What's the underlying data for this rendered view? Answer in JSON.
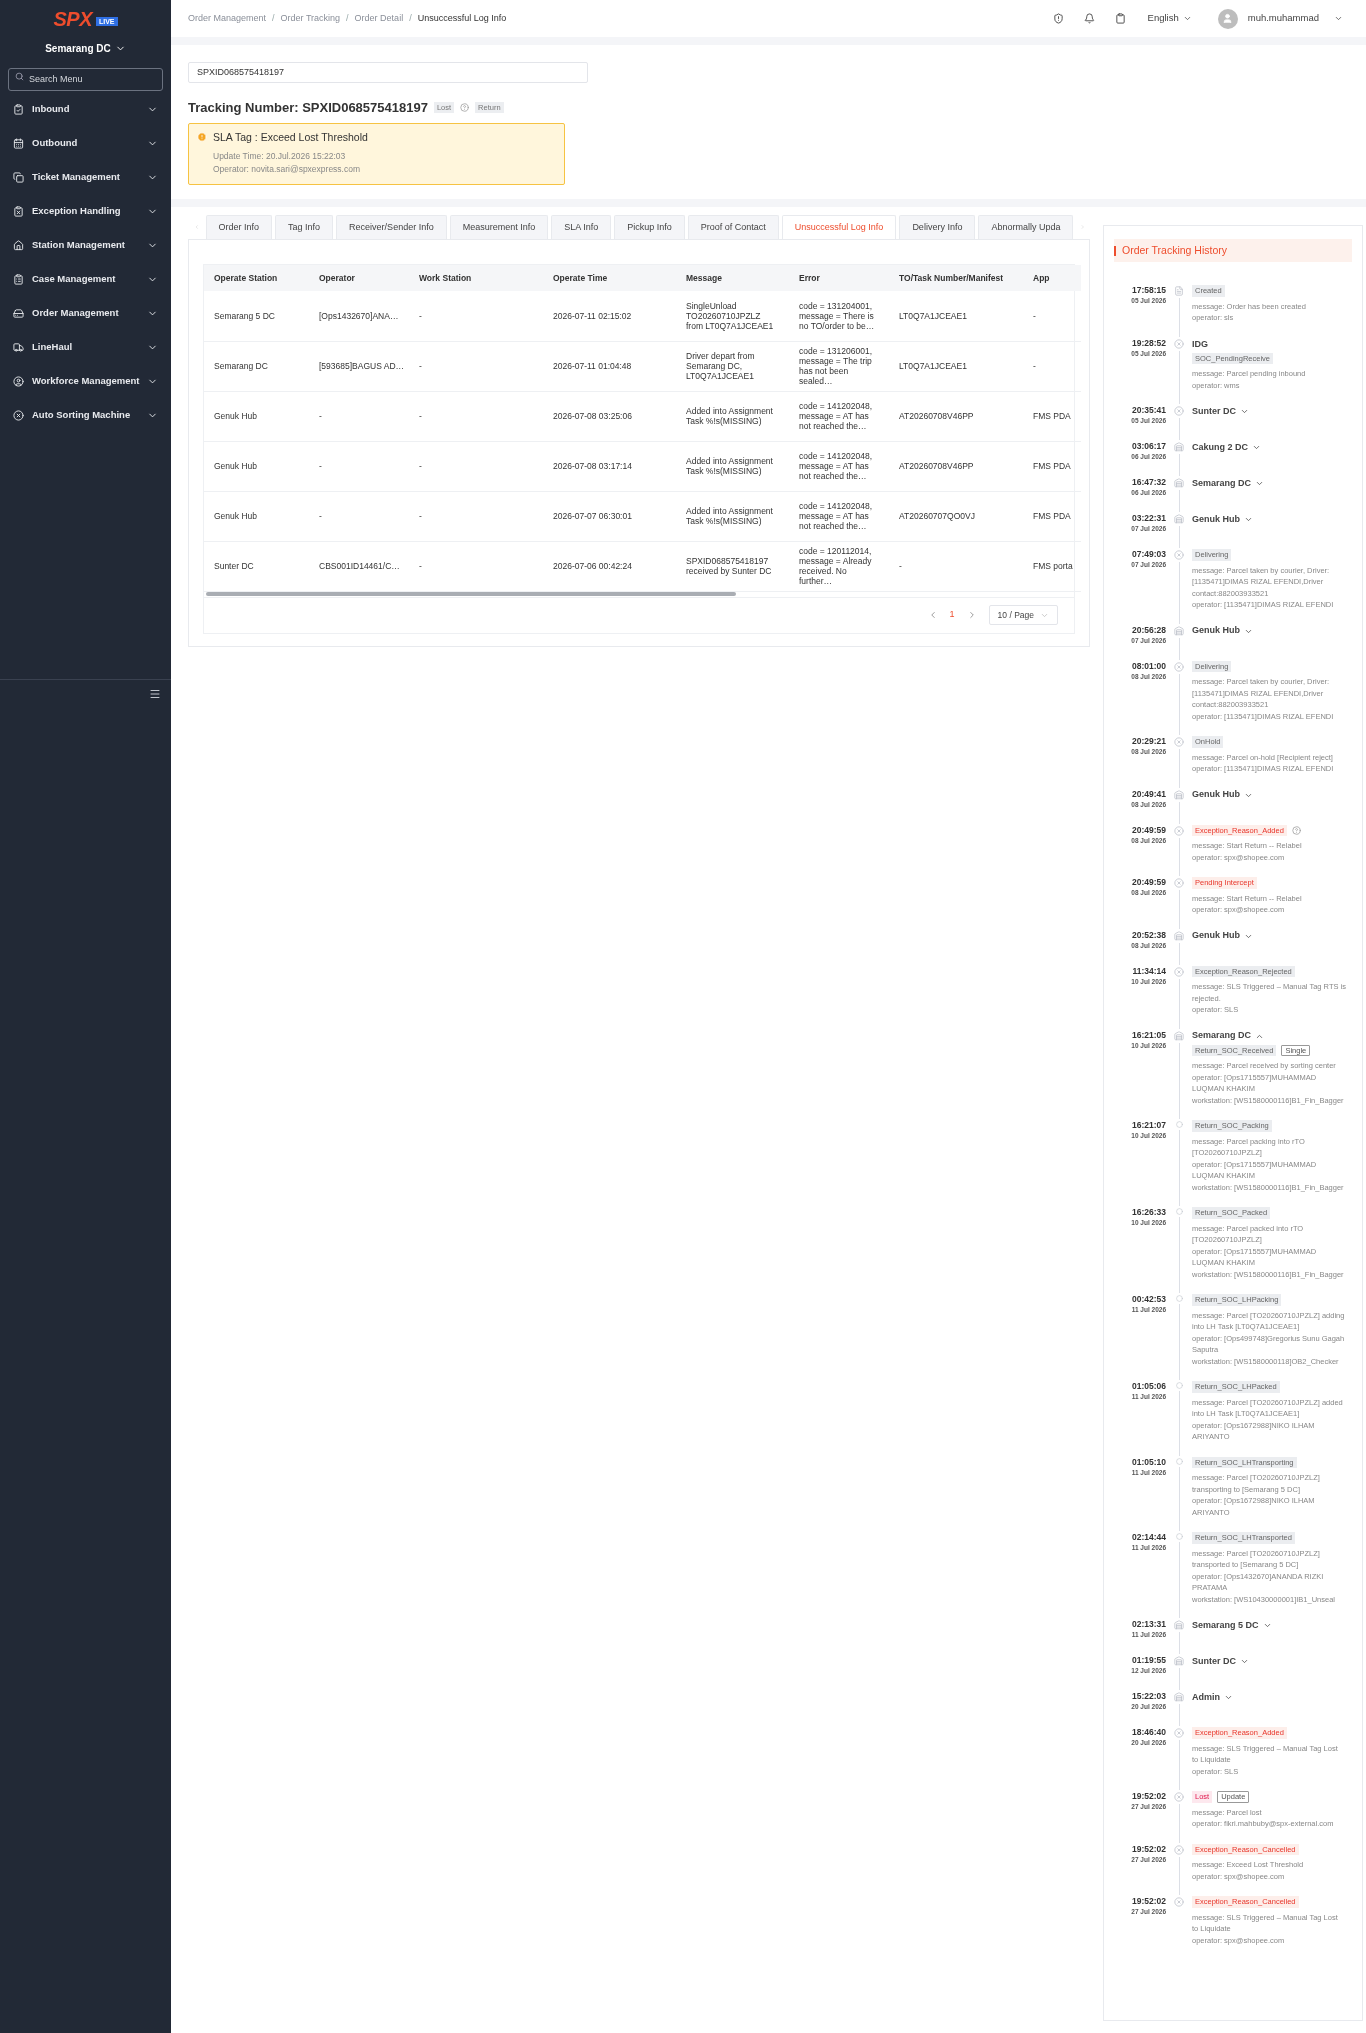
{
  "sidebar": {
    "logo": "SPX",
    "badge": "LIVE",
    "station": "Semarang DC",
    "search": {
      "placeholder": "Search Menu"
    },
    "items": [
      {
        "label": "Inbound"
      },
      {
        "label": "Outbound"
      },
      {
        "label": "Ticket Management"
      },
      {
        "label": "Exception Handling"
      },
      {
        "label": "Station Management"
      },
      {
        "label": "Case Management"
      },
      {
        "label": "Order Management"
      },
      {
        "label": "LineHaul"
      },
      {
        "label": "Workforce Management"
      },
      {
        "label": "Auto Sorting Machine"
      }
    ]
  },
  "header": {
    "separators": [
      "/",
      "/",
      "/"
    ],
    "breadcrumbs": [
      {
        "label": "Order Management",
        "current": false
      },
      {
        "label": "Order Tracking",
        "current": false
      },
      {
        "label": "Order Detail",
        "current": false
      },
      {
        "label": "Unsuccessful Log Info",
        "current": true
      }
    ],
    "language": "English",
    "user": "muh.muhammad"
  },
  "search_field": {
    "value": "SPXID068575418197"
  },
  "tracking": {
    "title": "Tracking Number: SPXID068575418197",
    "status_tag": "Lost",
    "type_tag": "Return"
  },
  "sla_alert": {
    "title": "SLA Tag : Exceed Lost Threshold",
    "lines": [
      "Update Time: 20.Jul.2026 15:22:03",
      "Operator: novita.sari@spxexpress.com"
    ]
  },
  "tabs": [
    {
      "label": "Order Info",
      "selected": false
    },
    {
      "label": "Tag Info",
      "selected": false
    },
    {
      "label": "Receiver/Sender Info",
      "selected": false
    },
    {
      "label": "Measurement Info",
      "selected": false
    },
    {
      "label": "SLA Info",
      "selected": false
    },
    {
      "label": "Pickup Info",
      "selected": false
    },
    {
      "label": "Proof of Contact",
      "selected": false
    },
    {
      "label": "Unsuccessful Log Info",
      "selected": true
    },
    {
      "label": "Delivery Info",
      "selected": false
    },
    {
      "label": "Abnormally Upda",
      "selected": false
    }
  ],
  "table": {
    "columns": [
      "Operate Station",
      "Operator",
      "Work Station",
      "Operate Time",
      "Message",
      "Error",
      "TO/Task Number/Manifest",
      "App"
    ],
    "rows": [
      [
        "Semarang 5 DC",
        "[Ops1432670]ANA…",
        "-",
        "2026-07-11 02:15:02",
        "SingleUnload TO20260710JPZLZ from LT0Q7A1JCEAE1",
        "code = 131204001, message = There is no TO/order to be…",
        "LT0Q7A1JCEAE1",
        "-"
      ],
      [
        "Semarang DC",
        "[593685]BAGUS AD…",
        "-",
        "2026-07-11 01:04:48",
        "Driver depart from Semarang DC, LT0Q7A1JCEAE1",
        "code = 131206001, message = The trip has not been sealed…",
        "LT0Q7A1JCEAE1",
        "-"
      ],
      [
        "Genuk Hub",
        "-",
        "-",
        "2026-07-08 03:25:06",
        "Added into Assignment Task %!s(MISSING)",
        "code = 141202048, message = AT has not reached the…",
        "AT20260708V46PP",
        "FMS PDA"
      ],
      [
        "Genuk Hub",
        "-",
        "-",
        "2026-07-08 03:17:14",
        "Added into Assignment Task %!s(MISSING)",
        "code = 141202048, message = AT has not reached the…",
        "AT20260708V46PP",
        "FMS PDA"
      ],
      [
        "Genuk Hub",
        "-",
        "-",
        "2026-07-07 06:30:01",
        "Added into Assignment Task %!s(MISSING)",
        "code = 141202048, message = AT has not reached the…",
        "AT20260707QO0VJ",
        "FMS PDA"
      ],
      [
        "Sunter DC",
        "CBS001ID14461/C…",
        "-",
        "2026-07-06 00:42:24",
        "SPXID068575418197 received by Sunter DC",
        "code = 120112014, message = Already received. No further…",
        "-",
        "FMS porta"
      ]
    ]
  },
  "pagination": {
    "pages": [
      {
        "label": "1",
        "selected": true
      }
    ],
    "page_size": "10 / Page"
  },
  "history": {
    "title": "Order Tracking History",
    "events": [
      {
        "time": "17:58:15",
        "date": "05 Jul 2026",
        "kind": "doc",
        "tags": [
          {
            "kind": "grey",
            "text": "Created"
          }
        ],
        "lines": [
          "message: Order has been created",
          "operator: sls"
        ]
      },
      {
        "time": "19:28:52",
        "date": "05 Jul 2026",
        "kind": "cross",
        "title": {
          "kind": "plain",
          "text": "IDG"
        },
        "tags": [
          {
            "kind": "grey",
            "text": "SOC_PendingReceive"
          }
        ],
        "lines": [
          "message: Parcel pending inbound",
          "operator: wms"
        ]
      },
      {
        "time": "20:35:41",
        "date": "05 Jul 2026",
        "kind": "cross",
        "title": {
          "kind": "station",
          "text": "Sunter DC",
          "expanded": false
        }
      },
      {
        "time": "03:06:17",
        "date": "06 Jul 2026",
        "kind": "building",
        "title": {
          "kind": "station",
          "text": "Cakung 2 DC",
          "expanded": false
        }
      },
      {
        "time": "16:47:32",
        "date": "06 Jul 2026",
        "kind": "building",
        "title": {
          "kind": "station",
          "text": "Semarang DC",
          "expanded": false
        }
      },
      {
        "time": "03:22:31",
        "date": "07 Jul 2026",
        "kind": "building",
        "title": {
          "kind": "station",
          "text": "Genuk Hub",
          "expanded": false
        }
      },
      {
        "time": "07:49:03",
        "date": "07 Jul 2026",
        "kind": "cross",
        "tags": [
          {
            "kind": "grey",
            "text": "Delivering"
          }
        ],
        "lines": [
          "message: Parcel taken by courier, Driver: [1135471]DIMAS RIZAL EFENDI,Driver contact:882003933521",
          "operator: [1135471]DIMAS RIZAL EFENDI"
        ]
      },
      {
        "time": "20:56:28",
        "date": "07 Jul 2026",
        "kind": "building",
        "title": {
          "kind": "station",
          "text": "Genuk Hub",
          "expanded": false
        }
      },
      {
        "time": "08:01:00",
        "date": "08 Jul 2026",
        "kind": "cross",
        "tags": [
          {
            "kind": "grey",
            "text": "Delivering"
          }
        ],
        "lines": [
          "message: Parcel taken by courier, Driver: [1135471]DIMAS RIZAL EFENDI,Driver contact:882003933521",
          "operator: [1135471]DIMAS RIZAL EFENDI"
        ]
      },
      {
        "time": "20:29:21",
        "date": "08 Jul 2026",
        "kind": "cross",
        "tags": [
          {
            "kind": "grey",
            "text": "OnHold"
          }
        ],
        "lines": [
          "message: Parcel on-hold [Recipient reject]",
          "operator: [1135471]DIMAS RIZAL EFENDI"
        ]
      },
      {
        "time": "20:49:41",
        "date": "08 Jul 2026",
        "kind": "building",
        "title": {
          "kind": "station",
          "text": "Genuk Hub",
          "expanded": false
        }
      },
      {
        "time": "20:49:59",
        "date": "08 Jul 2026",
        "kind": "cross",
        "tags": [
          {
            "kind": "red",
            "text": "Exception_Reason_Added"
          },
          {
            "kind": "help"
          }
        ],
        "lines": [
          "message: Start Return -- Relabel",
          "operator: spx@shopee.com"
        ]
      },
      {
        "time": "20:49:59",
        "date": "08 Jul 2026",
        "kind": "cross",
        "tags": [
          {
            "kind": "red",
            "text": "Pending Intercept"
          }
        ],
        "lines": [
          "message: Start Return -- Relabel",
          "operator: spx@shopee.com"
        ]
      },
      {
        "time": "20:52:38",
        "date": "08 Jul 2026",
        "kind": "building",
        "title": {
          "kind": "station",
          "text": "Genuk Hub",
          "expanded": false
        }
      },
      {
        "time": "11:34:14",
        "date": "10 Jul 2026",
        "kind": "cross",
        "tags": [
          {
            "kind": "grey",
            "text": "Exception_Reason_Rejected"
          }
        ],
        "lines": [
          "message: SLS Triggered – Manual Tag RTS is rejected.",
          "operator: SLS"
        ]
      },
      {
        "time": "16:21:05",
        "date": "10 Jul 2026",
        "kind": "building",
        "title": {
          "kind": "station",
          "text": "Semarang DC",
          "expanded": true
        },
        "tags": [
          {
            "kind": "grey",
            "text": "Return_SOC_Received"
          },
          {
            "kind": "outline",
            "text": "Single"
          }
        ],
        "lines": [
          "message: Parcel received by sorting center",
          "operator: [Ops1715557]MUHAMMAD LUQMAN KHAKIM",
          "workstation: [WS1580000116]B1_Fin_Bagger"
        ]
      },
      {
        "time": "16:21:07",
        "date": "10 Jul 2026",
        "kind": "dot",
        "tags": [
          {
            "kind": "grey",
            "text": "Return_SOC_Packing"
          }
        ],
        "lines": [
          "message: Parcel packing into rTO [TO20260710JPZLZ]",
          "operator: [Ops1715557]MUHAMMAD LUQMAN KHAKIM",
          "workstation: [WS1580000116]B1_Fin_Bagger"
        ]
      },
      {
        "time": "16:26:33",
        "date": "10 Jul 2026",
        "kind": "dot",
        "tags": [
          {
            "kind": "grey",
            "text": "Return_SOC_Packed"
          }
        ],
        "lines": [
          "message: Parcel packed into rTO [TO20260710JPZLZ]",
          "operator: [Ops1715557]MUHAMMAD LUQMAN KHAKIM",
          "workstation: [WS1580000116]B1_Fin_Bagger"
        ]
      },
      {
        "time": "00:42:53",
        "date": "11 Jul 2026",
        "kind": "dot",
        "tags": [
          {
            "kind": "grey",
            "text": "Return_SOC_LHPacking"
          }
        ],
        "lines": [
          "message: Parcel [TO20260710JPZLZ] adding into LH Task [LT0Q7A1JCEAE1]",
          "operator: [Ops499748]Gregorius Sunu Gagah Saputra",
          "workstation: [WS1580000118]OB2_Checker"
        ]
      },
      {
        "time": "01:05:06",
        "date": "11 Jul 2026",
        "kind": "dot",
        "tags": [
          {
            "kind": "grey",
            "text": "Return_SOC_LHPacked"
          }
        ],
        "lines": [
          "message: Parcel [TO20260710JPZLZ] added into LH Task [LT0Q7A1JCEAE1]",
          "operator: [Ops1672988]NIKO ILHAM ARIYANTO"
        ]
      },
      {
        "time": "01:05:10",
        "date": "11 Jul 2026",
        "kind": "dot",
        "tags": [
          {
            "kind": "grey",
            "text": "Return_SOC_LHTransporting"
          }
        ],
        "lines": [
          "message: Parcel [TO20260710JPZLZ] transporting to [Semarang 5 DC]",
          "operator: [Ops1672988]NIKO ILHAM ARIYANTO"
        ]
      },
      {
        "time": "02:14:44",
        "date": "11 Jul 2026",
        "kind": "dot",
        "tags": [
          {
            "kind": "grey",
            "text": "Return_SOC_LHTransported"
          }
        ],
        "lines": [
          "message: Parcel [TO20260710JPZLZ] transported to [Semarang 5 DC]",
          "operator: [Ops1432670]ANANDA RIZKI PRATAMA",
          "workstation: [WS10430000001]IB1_Unseal"
        ]
      },
      {
        "time": "02:13:31",
        "date": "11 Jul 2026",
        "kind": "building",
        "title": {
          "kind": "station",
          "text": "Semarang 5 DC",
          "expanded": false
        }
      },
      {
        "time": "01:19:55",
        "date": "12 Jul 2026",
        "kind": "building",
        "title": {
          "kind": "station",
          "text": "Sunter DC",
          "expanded": false
        }
      },
      {
        "time": "15:22:03",
        "date": "20 Jul 2026",
        "kind": "building",
        "title": {
          "kind": "station",
          "text": "Admin",
          "expanded": false
        }
      },
      {
        "time": "18:46:40",
        "date": "20 Jul 2026",
        "kind": "cross",
        "tags": [
          {
            "kind": "red",
            "text": "Exception_Reason_Added"
          }
        ],
        "lines": [
          "message: SLS Triggered – Manual Tag Lost to Liquidate",
          "operator: SLS"
        ]
      },
      {
        "time": "19:52:02",
        "date": "27 Jul 2026",
        "kind": "cross",
        "tags": [
          {
            "kind": "pink",
            "text": "Lost"
          },
          {
            "kind": "outline",
            "text": "Update"
          }
        ],
        "lines": [
          "message: Parcel lost",
          "operator: fikri.mahbuby@spx-external.com"
        ]
      },
      {
        "time": "19:52:02",
        "date": "27 Jul 2026",
        "kind": "cross",
        "tags": [
          {
            "kind": "red",
            "text": "Exception_Reason_Cancelled"
          }
        ],
        "lines": [
          "message: Exceed Lost Threshold",
          "operator: spx@shopee.com"
        ]
      },
      {
        "time": "19:52:02",
        "date": "27 Jul 2026",
        "kind": "cross",
        "tags": [
          {
            "kind": "red",
            "text": "Exception_Reason_Cancelled"
          }
        ],
        "lines": [
          "message: SLS Triggered – Manual Tag Lost to Liquidate",
          "operator: spx@shopee.com"
        ]
      }
    ]
  }
}
